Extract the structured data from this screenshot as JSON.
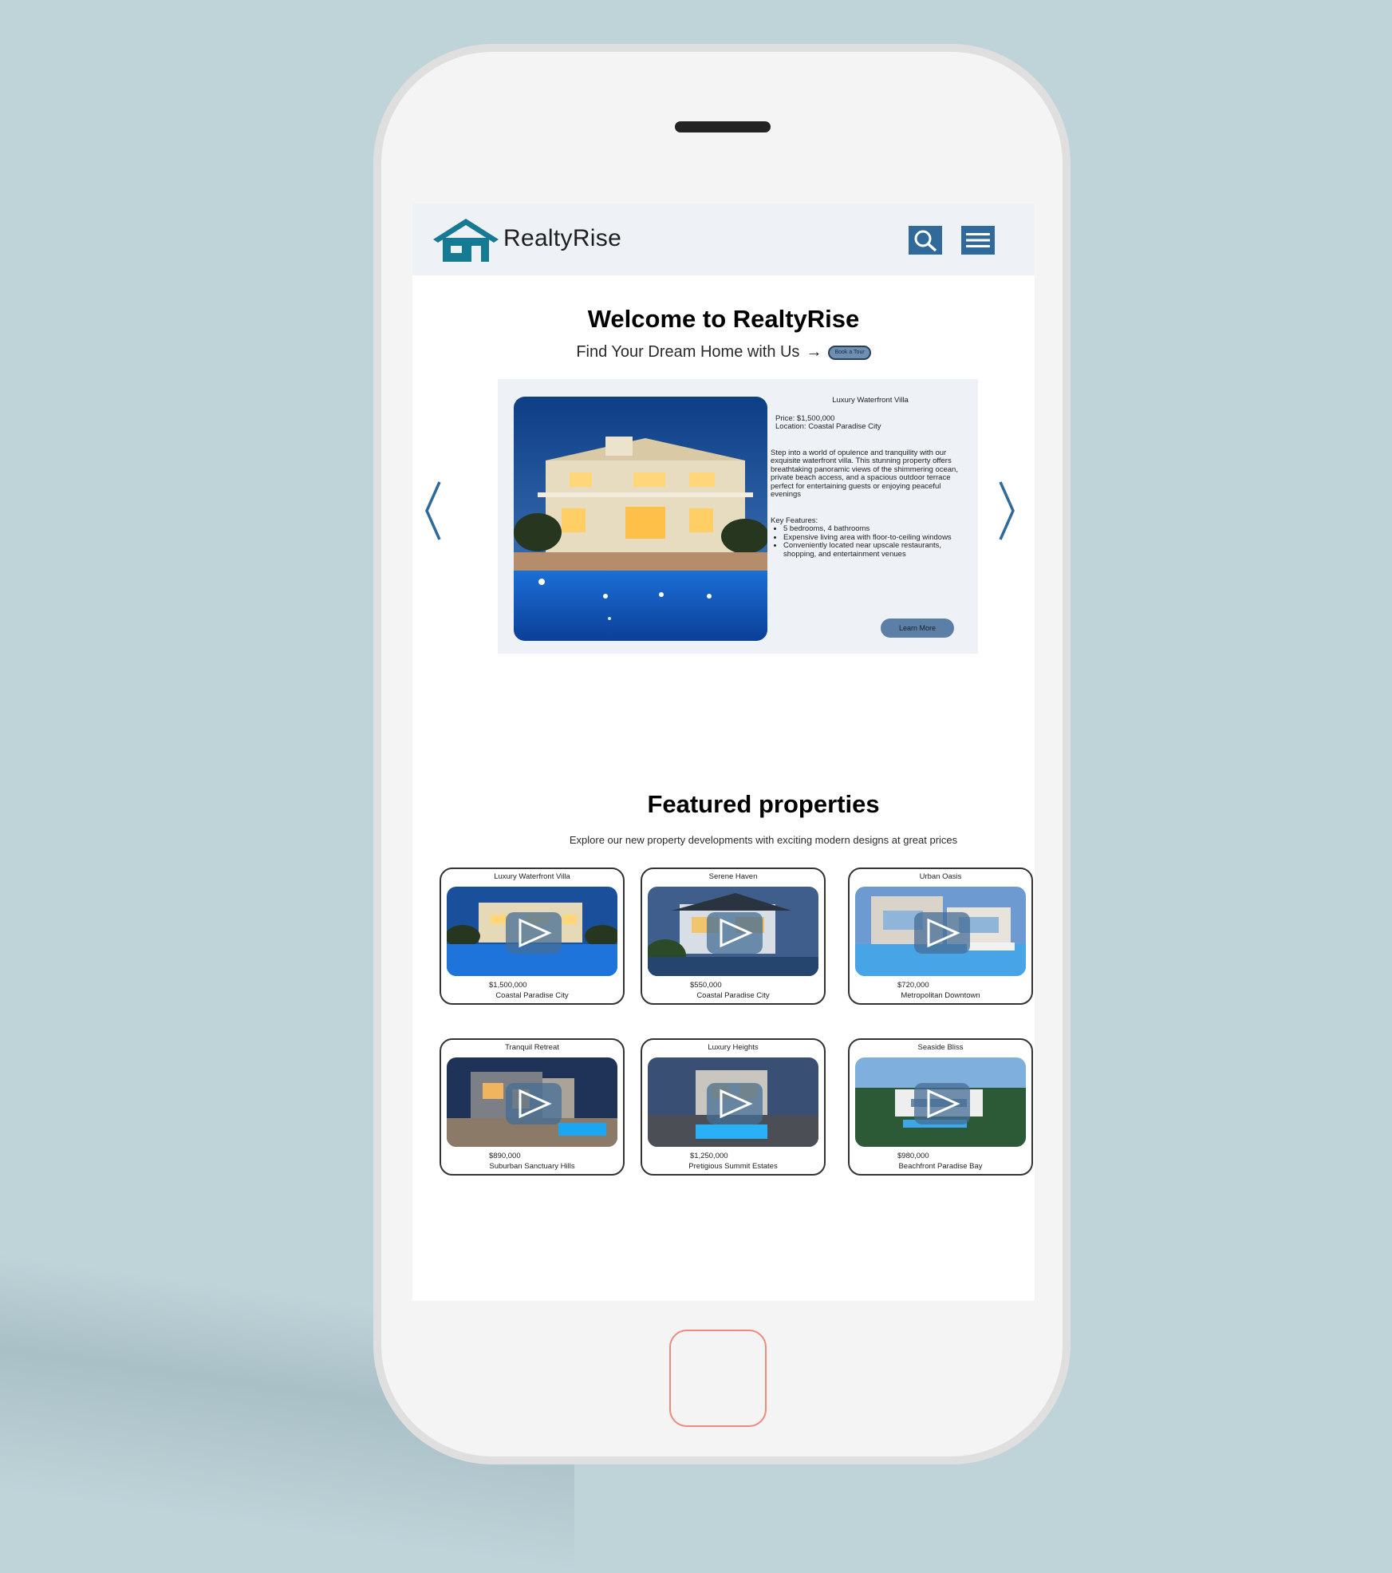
{
  "brand": {
    "name": "RealtyRise"
  },
  "hero": {
    "title": "Welcome to RealtyRise",
    "subtitle": "Find Your Dream Home with Us",
    "arrow": "→",
    "book_label": "Book a Tour"
  },
  "carousel": {
    "title": "Luxury Waterfront Villa",
    "price": "Price: $1,500,000",
    "location": "Location: Coastal Paradise City",
    "description": "Step into a world of opulence and tranquility with our exquisite waterfront villa. This stunning property offers breathtaking panoramic views of the shimmering ocean, private beach access, and a spacious outdoor terrace perfect for entertaining guests or enjoying peaceful evenings",
    "features_label": "Key Features:",
    "features": [
      "5 bedrooms, 4 bathrooms",
      "Expensive living area with floor-to-ceiling windows",
      "Conveniently located near upscale restaurants, shopping, and entertainment venues"
    ],
    "learn_more": "Learn More"
  },
  "featured": {
    "title": "Featured properties",
    "subtitle": "Explore our new property developments with exciting modern designs at great prices",
    "items": [
      {
        "name": "Luxury Waterfront Villa",
        "price": "$1,500,000",
        "location": "Coastal Paradise City"
      },
      {
        "name": "Serene Haven",
        "price": "$550,000",
        "location": "Coastal Paradise City"
      },
      {
        "name": "Urban Oasis",
        "price": "$720,000",
        "location": "Metropolitan Downtown"
      },
      {
        "name": "Tranquil Retreat",
        "price": "$890,000",
        "location": "Suburban Sanctuary Hills"
      },
      {
        "name": "Luxury Heights",
        "price": "$1,250,000",
        "location": "Pretigious Summit Estates"
      },
      {
        "name": "Seaside Bliss",
        "price": "$980,000",
        "location": "Beachfront Paradise Bay"
      }
    ]
  },
  "colors": {
    "background": "#bfd4d9",
    "accent": "#2f6a9a",
    "logo": "#167a93",
    "button": "#5b7fa5",
    "panel": "#eef2f6"
  },
  "icons": [
    "house-logo-icon",
    "search-icon",
    "menu-icon",
    "chevron-left-icon",
    "chevron-right-icon",
    "play-icon"
  ]
}
